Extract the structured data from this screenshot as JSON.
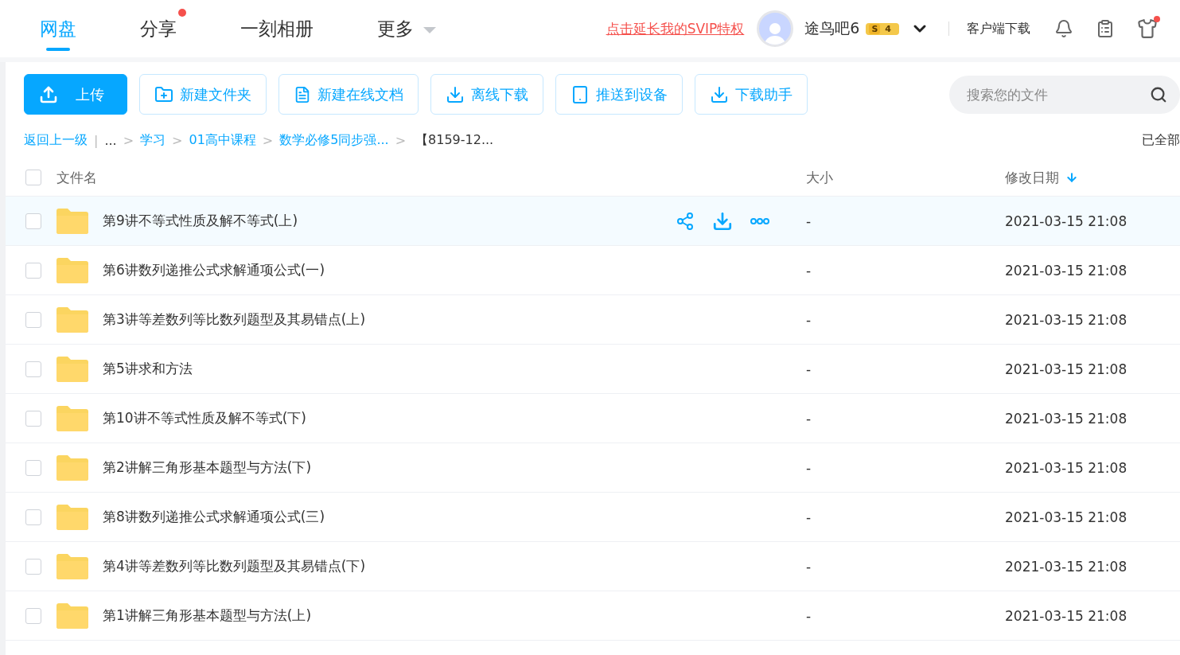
{
  "nav": {
    "tabs": [
      {
        "label": "网盘",
        "selected": true,
        "dot": false,
        "caret": false
      },
      {
        "label": "分享",
        "selected": false,
        "dot": true,
        "caret": false
      },
      {
        "label": "一刻相册",
        "selected": false,
        "dot": false,
        "caret": false
      },
      {
        "label": "更多",
        "selected": false,
        "dot": false,
        "caret": true
      }
    ],
    "promo_link": "点击延长我的SVIP特权",
    "user": {
      "name": "途鸟吧6",
      "badge_s": "S",
      "badge_level": "4"
    },
    "client_download": "客户端下载",
    "shirt_dot": true
  },
  "toolbar": {
    "buttons": [
      {
        "kind": "upload",
        "label": "上传",
        "primary": true
      },
      {
        "kind": "folder",
        "label": "新建文件夹",
        "primary": false
      },
      {
        "kind": "doc",
        "label": "新建在线文档",
        "primary": false
      },
      {
        "kind": "download",
        "label": "离线下载",
        "primary": false
      },
      {
        "kind": "device",
        "label": "推送到设备",
        "primary": false
      },
      {
        "kind": "download",
        "label": "下载助手",
        "primary": false
      }
    ],
    "search": {
      "placeholder": "搜索您的文件"
    }
  },
  "breadcrumb": {
    "back": "返回上一级",
    "pipe": "|",
    "separator": ">",
    "items": [
      "...",
      "学习",
      "01高中课程",
      "数学必修5同步强..."
    ],
    "current": "【8159-12...",
    "status": "已全部"
  },
  "table": {
    "columns": {
      "name": "文件名",
      "size": "大小",
      "date": "修改日期"
    },
    "sort_desc": true,
    "all_checked": false,
    "rows": [
      {
        "name": "第9讲不等式性质及解不等式(上)",
        "size": "-",
        "date": "2021-03-15 21:08",
        "hovered": true,
        "checked": false
      },
      {
        "name": "第6讲数列递推公式求解通项公式(一)",
        "size": "-",
        "date": "2021-03-15 21:08",
        "hovered": false,
        "checked": false
      },
      {
        "name": "第3讲等差数列等比数列题型及其易错点(上)",
        "size": "-",
        "date": "2021-03-15 21:08",
        "hovered": false,
        "checked": false
      },
      {
        "name": "第5讲求和方法",
        "size": "-",
        "date": "2021-03-15 21:08",
        "hovered": false,
        "checked": false
      },
      {
        "name": "第10讲不等式性质及解不等式(下)",
        "size": "-",
        "date": "2021-03-15 21:08",
        "hovered": false,
        "checked": false
      },
      {
        "name": "第2讲解三角形基本题型与方法(下)",
        "size": "-",
        "date": "2021-03-15 21:08",
        "hovered": false,
        "checked": false
      },
      {
        "name": "第8讲数列递推公式求解通项公式(三)",
        "size": "-",
        "date": "2021-03-15 21:08",
        "hovered": false,
        "checked": false
      },
      {
        "name": "第4讲等差数列等比数列题型及其易错点(下)",
        "size": "-",
        "date": "2021-03-15 21:08",
        "hovered": false,
        "checked": false
      },
      {
        "name": "第1讲解三角形基本题型与方法(上)",
        "size": "-",
        "date": "2021-03-15 21:08",
        "hovered": false,
        "checked": false
      }
    ]
  }
}
